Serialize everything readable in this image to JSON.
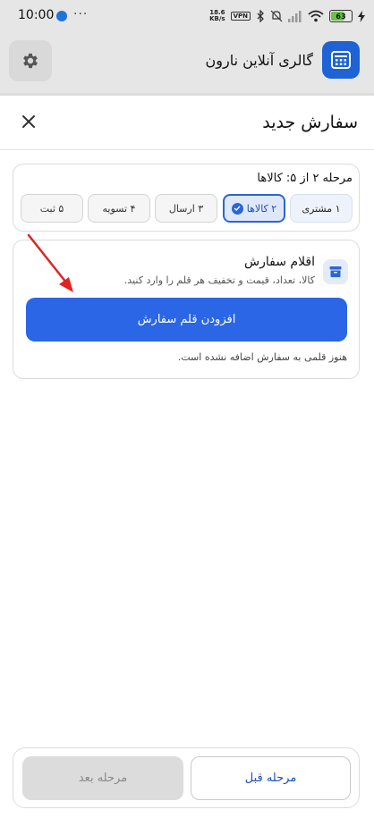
{
  "status_bar": {
    "time": "10:00",
    "dots": "···",
    "net_speed_value": "18.6",
    "net_speed_unit": "KB/s",
    "vpn": "VPN",
    "battery": "63"
  },
  "app_bar": {
    "title": "گالری آنلاین نارون"
  },
  "sheet": {
    "title": "سفارش جدید"
  },
  "steps": {
    "label": "مرحله ۲ از ۵: کالاها",
    "items": [
      {
        "label": "۱ مشتری",
        "state": "done"
      },
      {
        "label": "۲ کالاها",
        "state": "active"
      },
      {
        "label": "۳ ارسال",
        "state": "pending"
      },
      {
        "label": "۴ تسویه",
        "state": "pending"
      },
      {
        "label": "۵ ثبت",
        "state": "pending"
      }
    ]
  },
  "order_items": {
    "title": "اقلام سفارش",
    "subtitle": "کالا، تعداد، قیمت و تخفیف هر قلم را وارد کنید.",
    "add_button": "افزودن قلم سفارش",
    "empty": "هنوز قلمی به سفارش اضافه نشده است."
  },
  "nav": {
    "prev": "مرحله قبل",
    "next": "مرحله بعد"
  },
  "colors": {
    "primary": "#2a66e6",
    "annotation_arrow": "#e02424"
  }
}
